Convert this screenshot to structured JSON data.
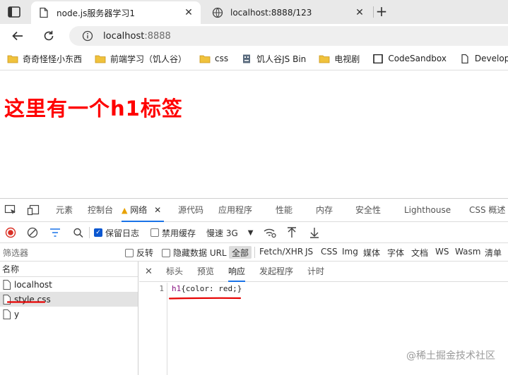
{
  "browser": {
    "tabs": [
      {
        "title": "node.js服务器学习1",
        "active": true
      },
      {
        "title": "localhost:8888/123",
        "active": false
      }
    ],
    "address": {
      "host": "localhost",
      "port": ":8888"
    },
    "bookmarks": [
      {
        "label": "奇奇怪怪小东西",
        "icon": "folder-icon"
      },
      {
        "label": "前端学习（饥人谷）",
        "icon": "folder-icon"
      },
      {
        "label": "css",
        "icon": "folder-icon"
      },
      {
        "label": "饥人谷JS Bin",
        "icon": "jsbin-icon"
      },
      {
        "label": "电视剧",
        "icon": "folder-icon"
      },
      {
        "label": "CodeSandbox",
        "icon": "square-icon"
      },
      {
        "label": "Developer",
        "icon": "page-icon"
      }
    ]
  },
  "page": {
    "heading": "这里有一个h1标签",
    "heading_color": "#ff0000"
  },
  "devtools": {
    "tabs": [
      "元素",
      "控制台",
      "网络",
      "源代码",
      "应用程序",
      "性能",
      "内存",
      "安全性",
      "Lighthouse",
      "CSS 概述"
    ],
    "active_tab": "网络",
    "toolbar": {
      "preserve_log": "保留日志",
      "disable_cache": "禁用缓存",
      "throttle": "慢速 3G"
    },
    "filter": {
      "placeholder": "筛选器",
      "invert": "反转",
      "hide_data_urls": "隐藏数据 URL",
      "types": [
        "全部",
        "Fetch/XHR",
        "JS",
        "CSS",
        "Img",
        "媒体",
        "字体",
        "文档",
        "WS",
        "Wasm",
        "清单"
      ],
      "selected_type": "全部"
    },
    "requests": {
      "header": "名称",
      "items": [
        "localhost",
        "style.css",
        "y"
      ],
      "selected": "style.css"
    },
    "detail": {
      "tabs": [
        "标头",
        "预览",
        "响应",
        "发起程序",
        "计时"
      ],
      "active_tab": "响应",
      "response": {
        "line_number": "1",
        "selector": "h1",
        "body": "{color: red;}"
      }
    }
  },
  "watermark": "@稀土掘金技术社区",
  "colors": {
    "accent": "#1a73e8",
    "annotation_red": "#e60000",
    "warning": "#e8a200"
  }
}
